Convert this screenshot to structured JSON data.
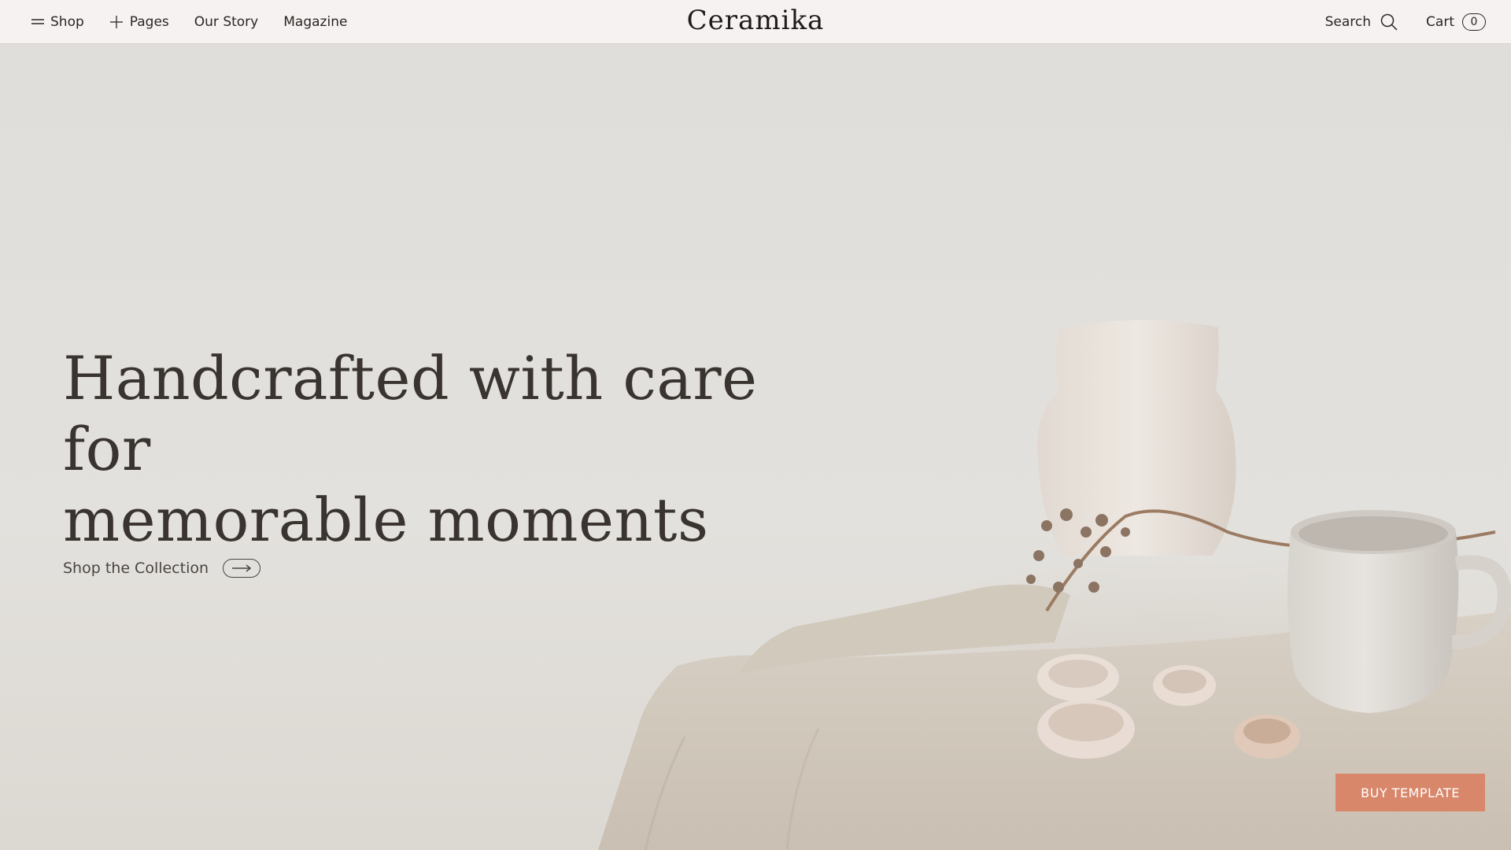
{
  "header": {
    "nav": [
      {
        "label": "Shop",
        "icon": "menu-icon"
      },
      {
        "label": "Pages",
        "icon": "plus-icon"
      },
      {
        "label": "Our Story"
      },
      {
        "label": "Magazine"
      }
    ],
    "logo": "Ceramika",
    "search_label": "Search",
    "cart_label": "Cart",
    "cart_count": "0"
  },
  "hero": {
    "headline_line1": "Handcrafted with care for",
    "headline_line2": "memorable moments",
    "cta_label": "Shop the Collection",
    "cta_icon": "arrow-right-icon"
  },
  "buy_button": "BUY TEMPLATE",
  "colors": {
    "header_bg": "#f5f2f1",
    "hero_bg": "#e2e0dc",
    "text": "#2b2623",
    "accent": "#d9876a"
  }
}
